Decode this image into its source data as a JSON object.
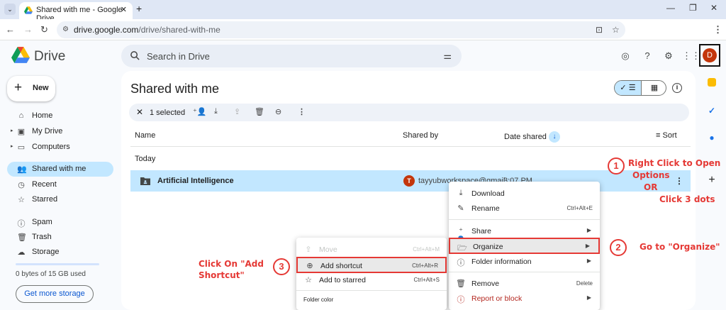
{
  "browser": {
    "tab_title": "Shared with me - Google Drive",
    "url_host": "drive.google.com",
    "url_path": "/drive/shared-with-me"
  },
  "app": {
    "name": "Drive",
    "search_placeholder": "Search in Drive"
  },
  "account": {
    "avatar_initial": "D"
  },
  "sidebar": {
    "new_label": "New",
    "items": [
      {
        "label": "Home"
      },
      {
        "label": "My Drive"
      },
      {
        "label": "Computers"
      },
      {
        "label": "Shared with me"
      },
      {
        "label": "Recent"
      },
      {
        "label": "Starred"
      },
      {
        "label": "Spam"
      },
      {
        "label": "Trash"
      },
      {
        "label": "Storage"
      }
    ],
    "storage_text": "0 bytes of 15 GB used",
    "get_storage_label": "Get more storage"
  },
  "main": {
    "title": "Shared with me",
    "selection_count": "1 selected",
    "columns": {
      "name": "Name",
      "shared_by": "Shared by",
      "date_shared": "Date shared",
      "sort": "Sort"
    },
    "group_label": "Today",
    "rows": [
      {
        "name": "Artificial Intelligence",
        "owner_initial": "T",
        "owner": "tayyubworkspace@gmail...",
        "date": "3:07 PM"
      }
    ]
  },
  "context_menu": {
    "items": [
      {
        "label": "Download",
        "shortcut": ""
      },
      {
        "label": "Rename",
        "shortcut": "Ctrl+Alt+E"
      },
      {
        "label": "Share",
        "shortcut": ""
      },
      {
        "label": "Organize",
        "shortcut": ""
      },
      {
        "label": "Folder information",
        "shortcut": ""
      },
      {
        "label": "Remove",
        "shortcut": "Delete"
      },
      {
        "label": "Report or block",
        "shortcut": ""
      }
    ]
  },
  "submenu": {
    "items": [
      {
        "label": "Move",
        "shortcut": "Ctrl+Alt+M"
      },
      {
        "label": "Add shortcut",
        "shortcut": "Ctrl+Alt+R"
      },
      {
        "label": "Add to starred",
        "shortcut": "Ctrl+Alt+S"
      }
    ],
    "folder_color_label": "Folder color"
  },
  "annotations": {
    "step1_number": "1",
    "step1_line1": "Right Click to Open",
    "step1_line2": "Options",
    "step1_line3": "OR",
    "step1_line4": "Click 3 dots",
    "step2_number": "2",
    "step2_text": "Go to \"Organize\"",
    "step3_number": "3",
    "step3_line1": "Click On \"Add",
    "step3_line2": "Shortcut\"",
    "color": "#e53935"
  }
}
